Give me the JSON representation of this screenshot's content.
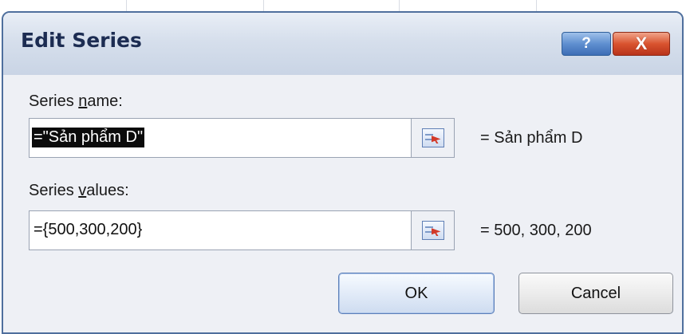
{
  "window": {
    "title": "Edit Series",
    "help_label": "?",
    "close_label": "X"
  },
  "series_name": {
    "label_pre": "Series ",
    "label_accel": "n",
    "label_post": "ame:",
    "value": "=\"Sản phẩm D\"",
    "preview": "= Sản phẩm D"
  },
  "series_values": {
    "label_pre": "Series ",
    "label_accel": "v",
    "label_post": "alues:",
    "value": "={500,300,200}",
    "preview": "= 500, 300, 200"
  },
  "buttons": {
    "ok": "OK",
    "cancel": "Cancel"
  },
  "icons": {
    "range_selector": "collapse-dialog-icon"
  }
}
